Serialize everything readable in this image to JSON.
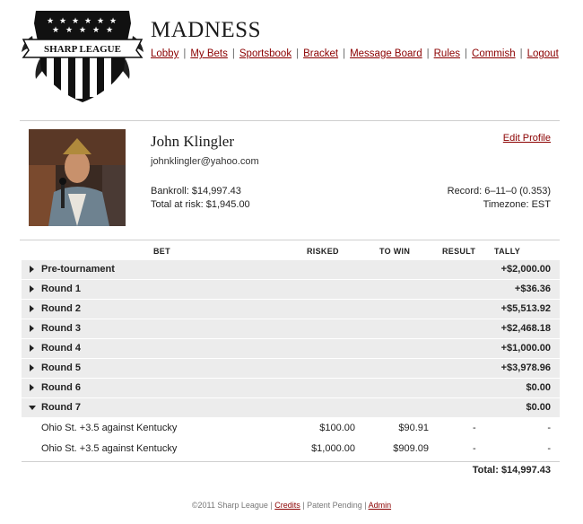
{
  "logo": {
    "text": "SHARP LEAGUE"
  },
  "site_title": "MADNESS",
  "nav": [
    "Lobby",
    "My Bets",
    "Sportsbook",
    "Bracket",
    "Message Board",
    "Rules",
    "Commish",
    "Logout"
  ],
  "profile": {
    "name": "John Klingler",
    "email": "johnklingler@yahoo.com",
    "edit_label": "Edit Profile",
    "bankroll": "Bankroll: $14,997.43",
    "at_risk": "Total at risk: $1,945.00",
    "record": "Record: 6–11–0 (0.353)",
    "timezone": "Timezone: EST"
  },
  "table": {
    "headers": {
      "bet": "BET",
      "risked": "RISKED",
      "to_win": "TO WIN",
      "result": "RESULT",
      "tally": "TALLY"
    },
    "groups": [
      {
        "label": "Pre-tournament",
        "tally": "+$2,000.00"
      },
      {
        "label": "Round 1",
        "tally": "+$36.36"
      },
      {
        "label": "Round 2",
        "tally": "+$5,513.92"
      },
      {
        "label": "Round 3",
        "tally": "+$2,468.18"
      },
      {
        "label": "Round 4",
        "tally": "+$1,000.00"
      },
      {
        "label": "Round 5",
        "tally": "+$3,978.96"
      },
      {
        "label": "Round 6",
        "tally": "$0.00"
      },
      {
        "label": "Round 7",
        "tally": "$0.00"
      }
    ],
    "bets": [
      {
        "bet": "Ohio St. +3.5 against Kentucky",
        "risked": "$100.00",
        "to_win": "$90.91",
        "result": "-",
        "tally": "-"
      },
      {
        "bet": "Ohio St. +3.5 against Kentucky",
        "risked": "$1,000.00",
        "to_win": "$909.09",
        "result": "-",
        "tally": "-"
      }
    ],
    "total": "Total: $14,997.43"
  },
  "footer": {
    "copyright": "©2011 Sharp League",
    "credits": "Credits",
    "patent": "Patent Pending",
    "admin": "Admin"
  },
  "colors": {
    "link": "#8b0000",
    "row_bg": "#ececec"
  }
}
